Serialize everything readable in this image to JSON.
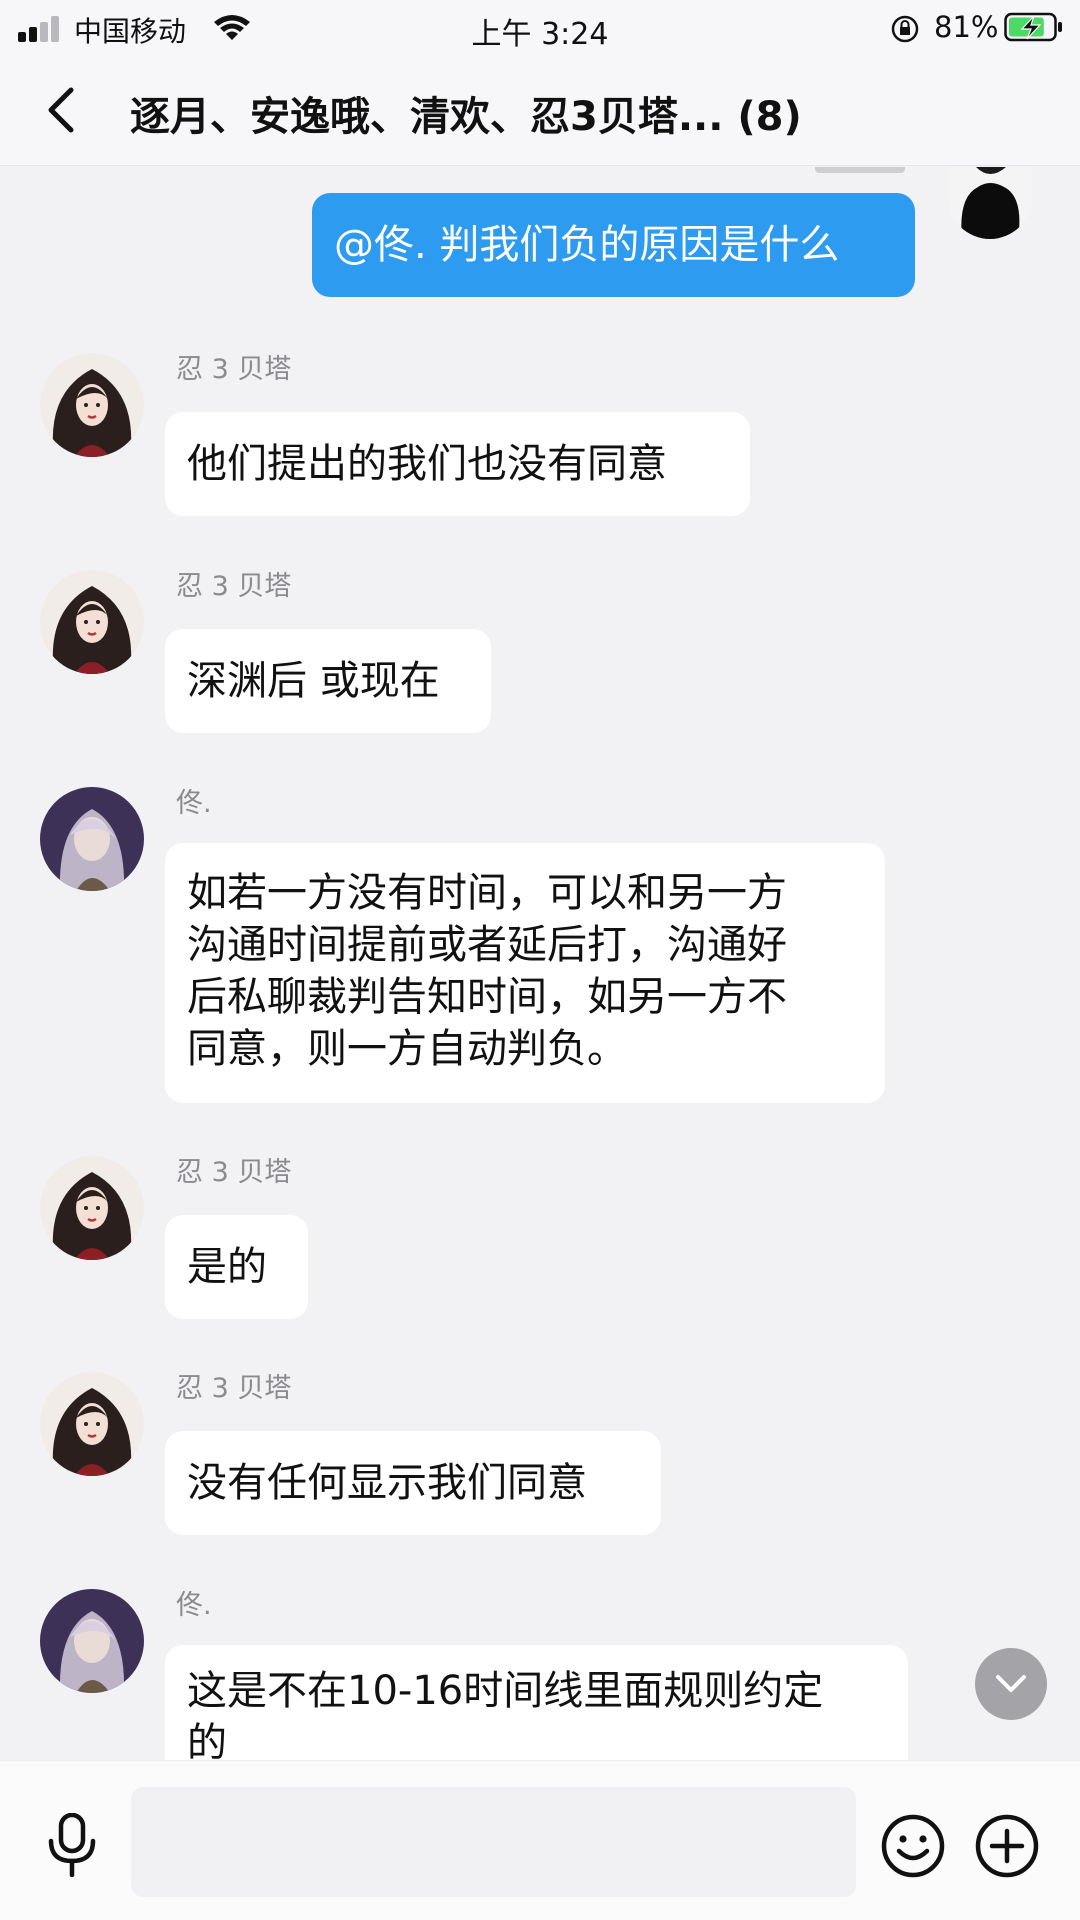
{
  "status_bar": {
    "carrier": "中国移动",
    "time": "上午 3:24",
    "battery_percent": "81%",
    "battery_level": 0.81,
    "icons": [
      "signal-icon",
      "wifi-icon",
      "rotation-lock-icon",
      "battery-charging-icon"
    ]
  },
  "nav": {
    "back_icon": "chevron-left-icon",
    "title": "逐月、安逸哦、清欢、忍3贝塔... (8)"
  },
  "self_message": {
    "text": "@佟. 判我们负的原因是什么"
  },
  "messages": [
    {
      "sender": "忍 3 贝塔",
      "avatar": "dark-hair-girl-avatar",
      "lines": [
        "他们提出的我们也没有同意"
      ]
    },
    {
      "sender": "忍 3 贝塔",
      "avatar": "dark-hair-girl-avatar",
      "lines": [
        "深渊后 或现在"
      ]
    },
    {
      "sender": "佟.",
      "avatar": "silver-hair-avatar",
      "lines": [
        "如若一方没有时间，可以和另一方",
        "沟通时间提前或者延后打，沟通好",
        "后私聊裁判告知时间，如另一方不",
        "同意，则一方自动判负。"
      ]
    },
    {
      "sender": "忍 3 贝塔",
      "avatar": "dark-hair-girl-avatar",
      "lines": [
        "是的"
      ]
    },
    {
      "sender": "忍 3 贝塔",
      "avatar": "dark-hair-girl-avatar",
      "lines": [
        "没有任何显示我们同意"
      ]
    },
    {
      "sender": "佟.",
      "avatar": "silver-hair-avatar",
      "lines": [
        "这是不在10-16时间线里面规则约定",
        "的"
      ]
    }
  ],
  "input_bar": {
    "placeholder": "",
    "icons": [
      "microphone-icon",
      "emoji-icon",
      "plus-icon"
    ]
  },
  "scroll_icon": "chevron-down-icon",
  "colors": {
    "background": "#f2f2f4",
    "self_bubble": "#2d9bf0",
    "other_bubble": "#ffffff",
    "sender_name": "#8a8a8f"
  }
}
